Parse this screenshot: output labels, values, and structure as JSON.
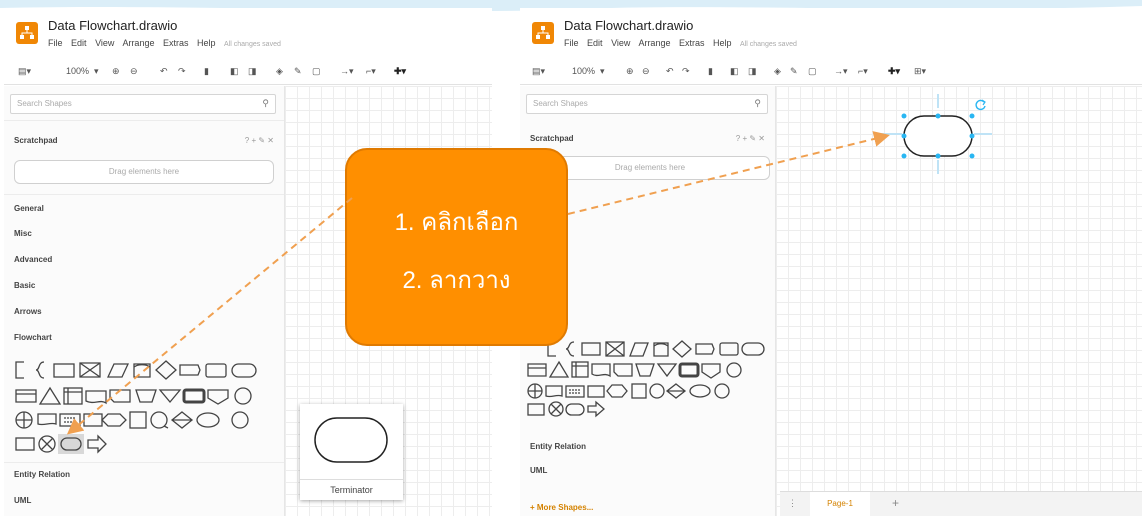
{
  "left": {
    "app": {
      "title": "Data Flowchart.drawio",
      "saved_status": "All changes saved"
    },
    "menu": [
      "File",
      "Edit",
      "View",
      "Arrange",
      "Extras",
      "Help"
    ],
    "toolbar": {
      "zoom": "100%"
    },
    "search": {
      "placeholder": "Search Shapes"
    },
    "scratchpad": {
      "title": "Scratchpad",
      "drag_hint": "Drag elements here"
    },
    "categories": [
      "General",
      "Misc",
      "Advanced",
      "Basic",
      "Arrows",
      "Flowchart"
    ],
    "bottom_categories": [
      "Entity Relation",
      "UML"
    ],
    "tooltip": {
      "label": "Terminator"
    }
  },
  "right": {
    "app": {
      "title": "Data Flowchart.drawio",
      "saved_status": "All changes saved"
    },
    "menu": [
      "File",
      "Edit",
      "View",
      "Arrange",
      "Extras",
      "Help"
    ],
    "toolbar": {
      "zoom": "100%"
    },
    "search": {
      "placeholder": "Search Shapes"
    },
    "scratchpad": {
      "title": "Scratchpad",
      "drag_hint": "Drag elements here"
    },
    "bottom_categories": [
      "Entity Relation",
      "UML"
    ],
    "more_shapes": "+ More Shapes...",
    "page_tab": "Page-1",
    "add_page": "+"
  },
  "callout": {
    "step1": "1. คลิกเลือก",
    "step2": "2. ลากวาง"
  },
  "icons": [
    "drawio-logo-icon",
    "search-icon",
    "zoom-in-icon",
    "zoom-out-icon",
    "undo-icon",
    "redo-icon",
    "delete-icon",
    "fill-icon",
    "line-color-icon",
    "shadow-icon",
    "waypoint-icon",
    "plus-icon",
    "table-icon",
    "rotate-icon"
  ],
  "colors": {
    "accent": "#ff8f00",
    "drawio_orange": "#f08705",
    "selection": "#29b6f2",
    "arrow": "#f0a050"
  }
}
